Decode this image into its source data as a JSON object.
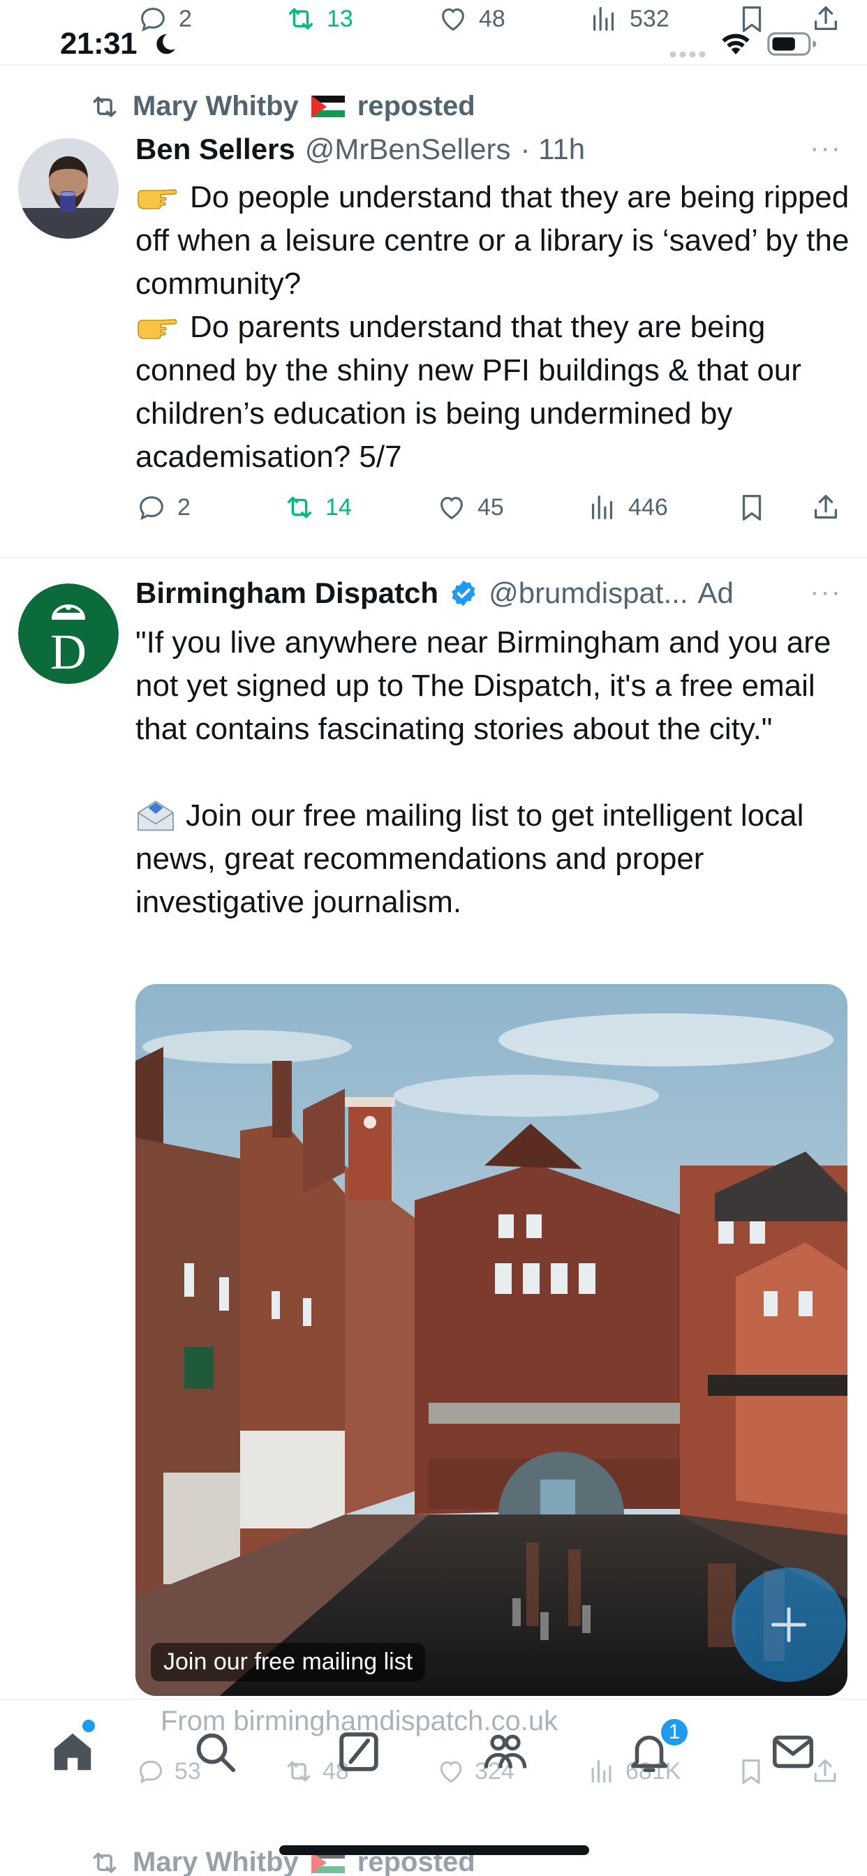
{
  "status_bar": {
    "time": "21:31"
  },
  "top_partial_actions": {
    "replies": "2",
    "reposts": "13",
    "likes": "48",
    "views": "532"
  },
  "tweet1": {
    "repost_by": "Mary Whitby",
    "repost_suffix": "reposted",
    "name": "Ben Sellers",
    "handle": "@MrBenSellers",
    "time": "· 11h",
    "more": "···",
    "lines": [
      "Do people understand that they are being ripped off when a leisure centre or a library is ‘saved’ by the community?",
      "Do parents understand that they are being conned by the shiny new PFI buildings & that our children’s education is being undermined by academisation? 5/7"
    ],
    "actions": {
      "replies": "2",
      "reposts": "14",
      "likes": "45",
      "views": "446"
    }
  },
  "tweet2": {
    "name": "Birmingham Dispatch",
    "handle": "@brumdispat...",
    "ad_label": "Ad",
    "more": "···",
    "para1": "\"If you live anywhere near Birmingham and you are not yet signed up to The Dispatch, it's a free email that contains fascinating stories about the city.\"",
    "para2": "Join our free mailing list to get intelligent local news, great recommendations and proper investigative journalism.",
    "image_caption": "Join our free mailing list",
    "from_line": "From birminghamdispatch.co.uk",
    "actions": {
      "replies": "53",
      "reposts": "48",
      "likes": "324",
      "views": "681K"
    }
  },
  "bottom_nav": {
    "items": [
      "home-icon",
      "search-icon",
      "grok-icon",
      "communities-icon",
      "notifications-icon",
      "messages-icon"
    ],
    "notification_count": "1"
  },
  "next_tweet": {
    "repost_by": "Mary Whitby",
    "repost_suffix": "reposted"
  },
  "colors": {
    "accent": "#1d9bf0",
    "repost_green": "#00ba7c",
    "secondary_text": "#536471",
    "dispatch_green": "#0b6b3a"
  }
}
